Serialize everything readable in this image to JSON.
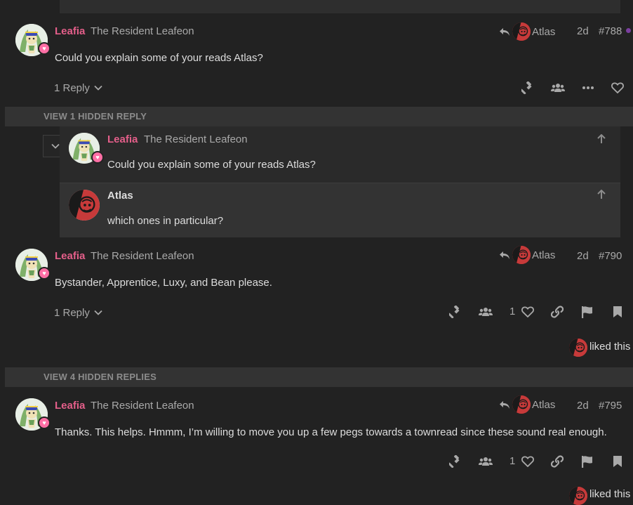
{
  "posts": [
    {
      "user": "Leafia",
      "title": "The Resident Leafeon",
      "reply_to": "Atlas",
      "age": "2d",
      "number": "#788",
      "text": "Could you explain some of your reads Atlas?",
      "replies": "1 Reply"
    },
    {
      "user": "Leafia",
      "title": "The Resident Leafeon",
      "reply_to": "Atlas",
      "age": "2d",
      "number": "#790",
      "text": "Bystander, Apprentice, Luxy, and Bean please.",
      "replies": "1 Reply",
      "like_count": "1",
      "liked_text": "liked this"
    },
    {
      "user": "Leafia",
      "title": "The Resident Leafeon",
      "reply_to": "Atlas",
      "age": "2d",
      "number": "#795",
      "text": "Thanks. This helps. Hmmm, I’m willing to move you up a few pegs towards a townread since these sound real enough.",
      "like_count": "1",
      "liked_text": "liked this"
    }
  ],
  "hidden_replies": {
    "first": "VIEW 1 HIDDEN REPLY",
    "second": "VIEW 4 HIDDEN REPLIES"
  },
  "embedded": {
    "quote": {
      "user": "Leafia",
      "title": "The Resident Leafeon",
      "text": "Could you explain some of your reads Atlas?"
    },
    "reply": {
      "user": "Atlas",
      "text": "which ones in particular?"
    }
  },
  "colors": {
    "username": "#e45f8a",
    "background": "#222222",
    "hidden_bar": "#333333",
    "unread_dot": "#7b3fa0"
  },
  "icons": [
    "reply-arrow-icon",
    "gavel-icon",
    "group-icon",
    "ellipsis-icon",
    "heart-icon",
    "link-icon",
    "flag-icon",
    "bookmark-icon",
    "chevron-down-icon",
    "arrow-up-icon"
  ]
}
